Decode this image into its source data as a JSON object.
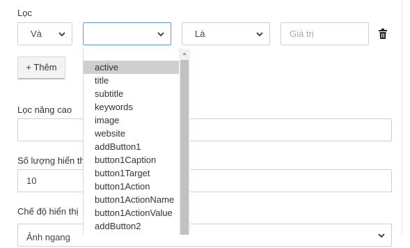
{
  "filter": {
    "title": "Lọc",
    "logic_select": "Và",
    "field_select": "",
    "operator_select": "Là",
    "value_placeholder": "Giá trị",
    "delete_icon": "trash-icon",
    "add_button": "+ Thêm"
  },
  "advanced": {
    "label": "Lọc nâng cao",
    "value": ""
  },
  "count": {
    "label": "Số lượng hiển thị",
    "value": "10"
  },
  "display_mode": {
    "label": "Chế độ hiển thị",
    "value": "Ảnh ngang"
  },
  "dropdown": {
    "selected": "active",
    "options": [
      "active",
      "title",
      "subtitle",
      "keywords",
      "image",
      "website",
      "addButton1",
      "button1Caption",
      "button1Target",
      "button1Action",
      "button1ActionName",
      "button1ActionValue",
      "addButton2"
    ]
  },
  "colors": {
    "text": "#333333",
    "border": "#cfcfcf",
    "selected_bg": "#cfcfcf"
  }
}
